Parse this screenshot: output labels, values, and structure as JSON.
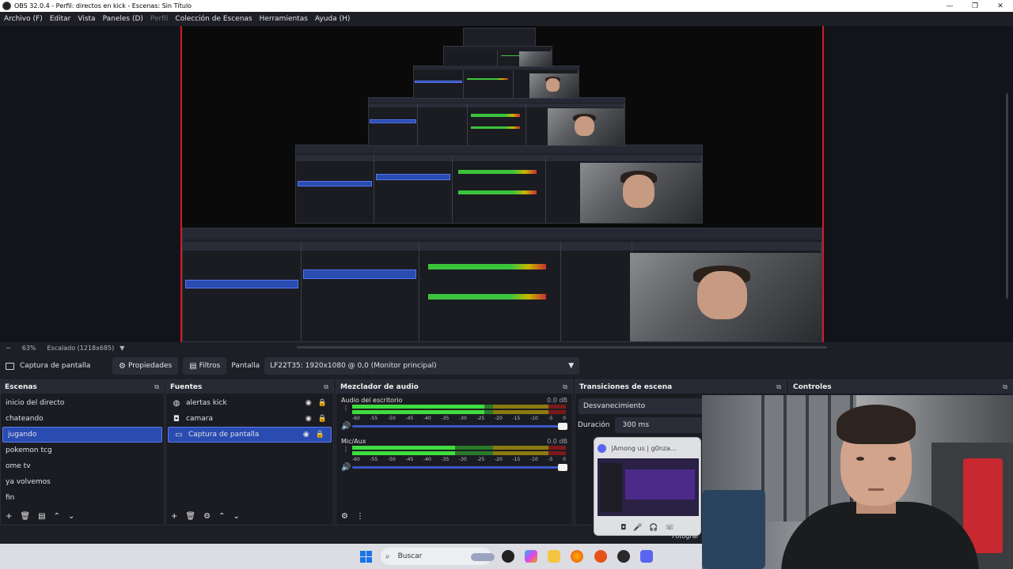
{
  "window": {
    "title": "OBS 32.0.4 - Perfil: directos en kick - Escenas: Sin Título",
    "minimize": "—",
    "maximize": "❐",
    "close": "✕"
  },
  "menu": [
    {
      "label": "Archivo (F)",
      "disabled": false
    },
    {
      "label": "Editar",
      "disabled": false
    },
    {
      "label": "Vista",
      "disabled": false
    },
    {
      "label": "Paneles (D)",
      "disabled": false
    },
    {
      "label": "Perfil",
      "disabled": true
    },
    {
      "label": "Colección de Escenas",
      "disabled": false
    },
    {
      "label": "Herramientas",
      "disabled": false
    },
    {
      "label": "Ayuda (H)",
      "disabled": false
    }
  ],
  "preview_status": {
    "minus": "−",
    "zoom": "63%",
    "scaling": "Escalado (1218x685)",
    "dropdown": "▼"
  },
  "source_toolbar": {
    "source_name": "Captura de pantalla",
    "properties_label": "Propiedades",
    "filters_label": "Filtros",
    "display_label": "Pantalla",
    "display_value": "LF22T35: 1920x1080 @ 0,0 (Monitor principal)",
    "dropdown_arrow": "▼"
  },
  "scenes": {
    "title": "Escenas",
    "items": [
      "inicio del directo",
      "chateando",
      "jugando",
      "pokemon tcg",
      "ome tv",
      "ya volvemos",
      "fin"
    ],
    "selected_index": 2
  },
  "sources": {
    "title": "Fuentes",
    "items": [
      {
        "label": "alertas kick",
        "icon": "browser-icon",
        "glyph": "◍"
      },
      {
        "label": "camara",
        "icon": "camera-icon",
        "glyph": "◘"
      },
      {
        "label": "Captura de pantalla",
        "icon": "monitor-icon",
        "glyph": "▭"
      }
    ],
    "selected_index": 2
  },
  "mixer": {
    "title": "Mezclador de audio",
    "channels": [
      {
        "name": "Audio del escritorio",
        "db": "0.0 dB",
        "level": 0.62
      },
      {
        "name": "Mic/Aux",
        "db": "0.0 dB",
        "level": 0.48
      }
    ],
    "ticks": [
      "-60",
      "-55",
      "-50",
      "-45",
      "-40",
      "-35",
      "-30",
      "-25",
      "-20",
      "-15",
      "-10",
      "-5",
      "0"
    ]
  },
  "transitions": {
    "title": "Transiciones de escena",
    "selected": "Desvanecimiento",
    "duration_label": "Duración",
    "duration_value": "300 ms"
  },
  "controls": {
    "title": "Controles",
    "partial_text": "Fotograf"
  },
  "discord_popup": {
    "title": "|Among us | g0nza..."
  },
  "taskbar": {
    "search_placeholder": "Buscar"
  },
  "colors": {
    "accent_selected": "#2a4bb0",
    "canvas_border": "#d01b2a",
    "meter_green": "#3fdc3f",
    "slider_blue": "#3b57c8"
  }
}
